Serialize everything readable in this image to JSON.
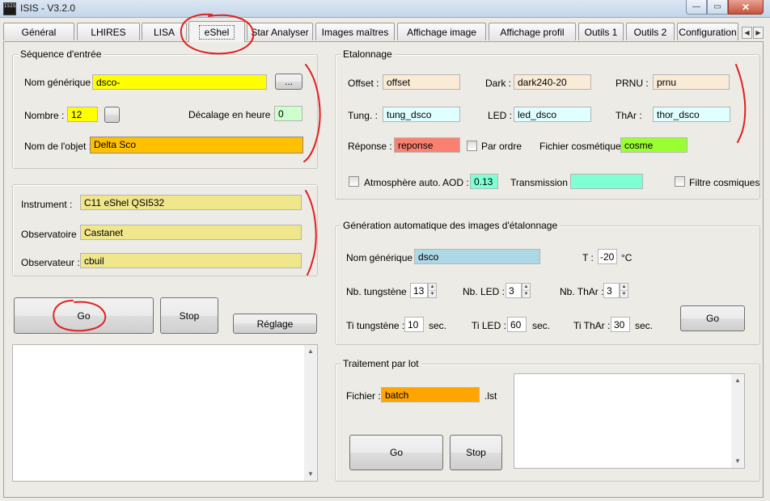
{
  "window": {
    "title": "ISIS - V3.2.0",
    "icon_text": "ISIS",
    "min_glyph": "—",
    "max_glyph": "▭",
    "close_glyph": "✕"
  },
  "tabs": [
    {
      "label": "Général"
    },
    {
      "label": "LHIRES"
    },
    {
      "label": "LISA"
    },
    {
      "label": "eShel",
      "active": true
    },
    {
      "label": "Star Analyser"
    },
    {
      "label": "Images maîtres"
    },
    {
      "label": "Affichage image"
    },
    {
      "label": "Affichage profil"
    },
    {
      "label": "Outils 1"
    },
    {
      "label": "Outils 2"
    },
    {
      "label": "Configuration"
    }
  ],
  "tab_scroll": {
    "left": "◀",
    "right": "▶"
  },
  "sequence": {
    "title": "Séquence d'entrée",
    "generic_name_label": "Nom générique :",
    "generic_name_value": "dsco-",
    "browse_label": "...",
    "count_label": "Nombre :",
    "count_value": "12",
    "offset_hours_label": "Décalage en heure :",
    "offset_hours_value": "0",
    "object_label": "Nom de l'objet :",
    "object_value": "Delta Sco"
  },
  "observer": {
    "instrument_label": "Instrument :",
    "instrument_value": "C11 eShel QSI532",
    "observatory_label": "Observatoire :",
    "observatory_value": "Castanet",
    "observer_label": "Observateur :",
    "observer_value": "cbuil"
  },
  "actions": {
    "go": "Go",
    "stop": "Stop",
    "settings": "Réglage"
  },
  "calibration": {
    "title": "Etalonnage",
    "offset_label": "Offset :",
    "offset_value": "offset",
    "dark_label": "Dark :",
    "dark_value": "dark240-20",
    "prnu_label": "PRNU :",
    "prnu_value": "prnu",
    "tung_label": "Tung. :",
    "tung_value": "tung_dsco",
    "led_label": "LED :",
    "led_value": "led_dsco",
    "thar_label": "ThAr :",
    "thar_value": "thor_dsco",
    "response_label": "Réponse :",
    "response_value": "reponse",
    "by_order_label": "Par ordre",
    "cosmetic_label": "Fichier cosmétique :",
    "cosmetic_value": "cosme",
    "auto_atmo_label": "Atmosphère auto.",
    "aod_label": "AOD :",
    "aod_value": "0.13",
    "transmission_label": "Transmission :",
    "transmission_value": "",
    "cosmic_filter_label": "Filtre cosmiques"
  },
  "auto_gen": {
    "title": "Génération automatique des images d'étalonnage",
    "generic_name_label": "Nom générique :",
    "generic_name_value": "dsco",
    "temp_label": "T :",
    "temp_value": "-20",
    "temp_unit": "°C",
    "nb_tung_label": "Nb. tungstène :",
    "nb_tung_value": "13",
    "nb_led_label": "Nb. LED :",
    "nb_led_value": "3",
    "nb_thar_label": "Nb. ThAr :",
    "nb_thar_value": "3",
    "ti_tung_label": "Ti tungstène :",
    "ti_tung_value": "10",
    "ti_led_label": "Ti LED :",
    "ti_led_value": "60",
    "ti_thar_label": "Ti ThAr :",
    "ti_thar_value": "30",
    "sec_unit": "sec.",
    "go": "Go",
    "spin_up": "▲",
    "spin_down": "▼"
  },
  "batch": {
    "title": "Traitement par lot",
    "file_label": "Fichier :",
    "file_value": "batch",
    "file_ext": ".lst",
    "go": "Go",
    "stop": "Stop"
  },
  "scroll_glyphs": {
    "up": "▲",
    "down": "▼"
  },
  "colors": {
    "yellow": "#ffff00",
    "gold": "#ffc000",
    "khaki": "#f0e68c",
    "peach": "#faebd7",
    "light_cyan": "#e0ffff",
    "salmon": "#fa8072",
    "lime": "#99ff33",
    "aquamarine": "#7fffd4",
    "light_blue": "#add8e6",
    "orange": "#ffa500",
    "annotation_red": "#e02020"
  }
}
